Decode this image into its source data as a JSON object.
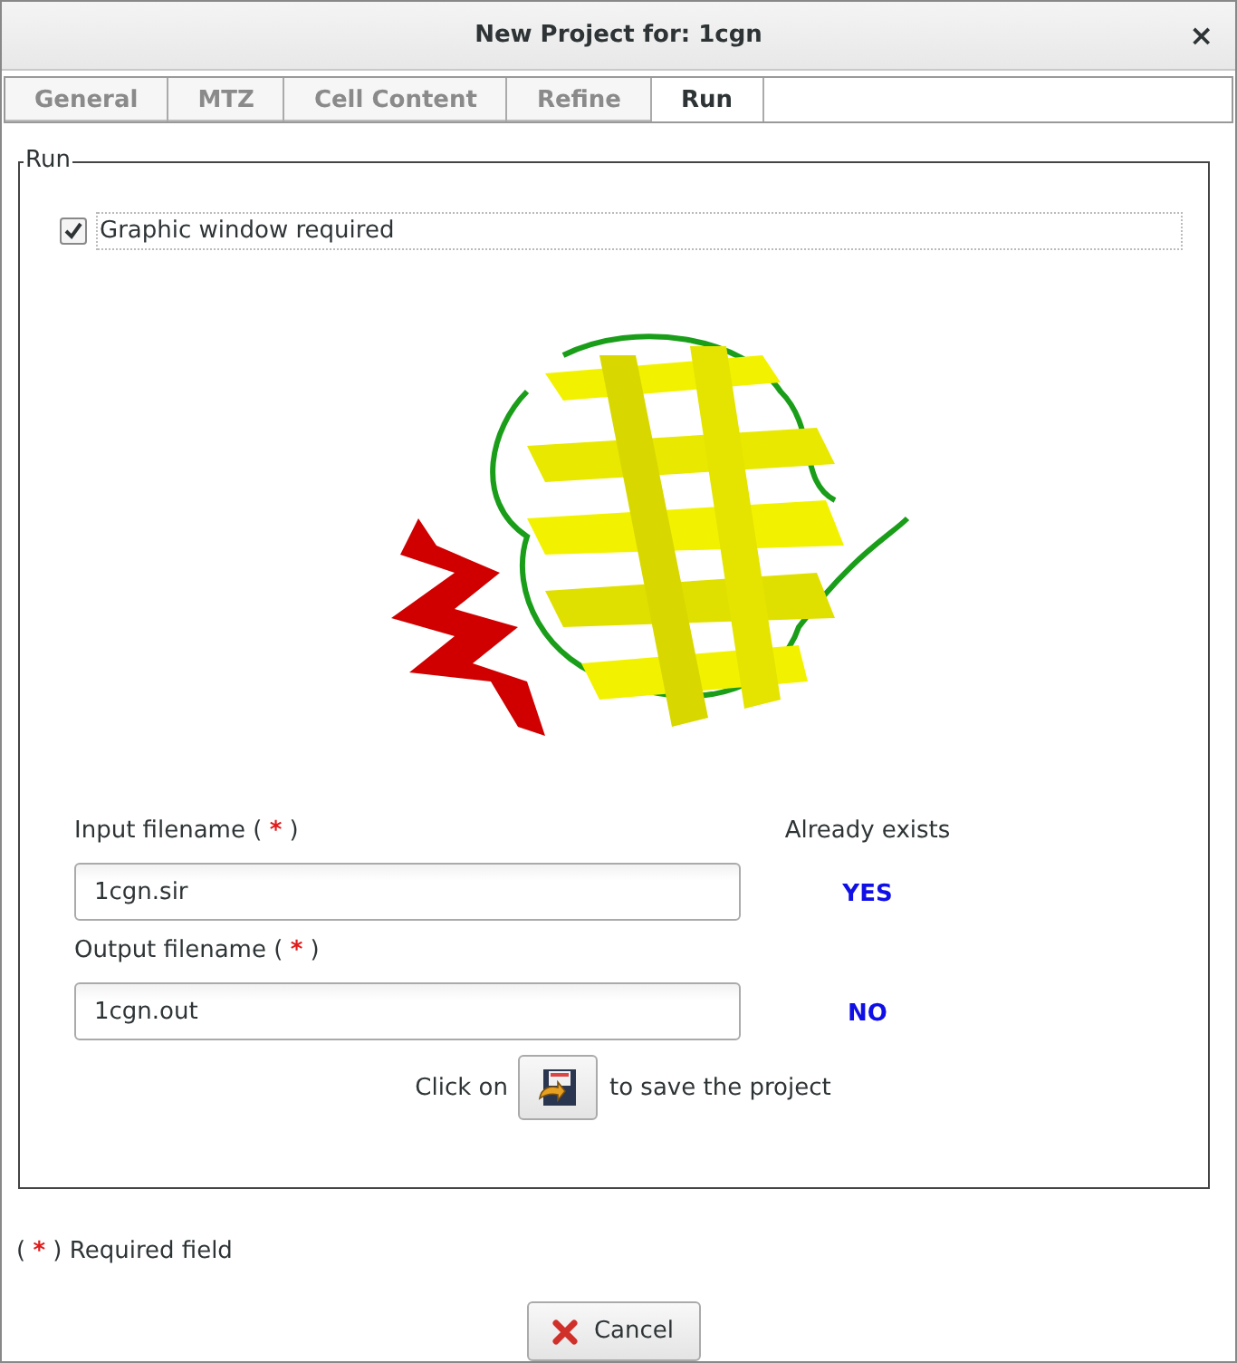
{
  "window": {
    "title": "New Project for: 1cgn",
    "close": "×"
  },
  "tabs": [
    {
      "label": "General",
      "selected": false
    },
    {
      "label": "MTZ",
      "selected": false
    },
    {
      "label": "Cell Content",
      "selected": false
    },
    {
      "label": "Refine",
      "selected": false
    },
    {
      "label": "Run",
      "selected": true
    }
  ],
  "group": {
    "title": "Run",
    "graphic_window": {
      "label": "Graphic window required",
      "checked": true
    },
    "exists_header": "Already exists",
    "files": [
      {
        "label": "Input filename",
        "open": "(",
        "mark": "*",
        "close": ")",
        "value": "1cgn.sir",
        "exists": "YES"
      },
      {
        "label": "Output filename",
        "open": "(",
        "mark": "*",
        "close": ")",
        "value": "1cgn.out",
        "exists": "NO"
      }
    ],
    "save_hint": {
      "before": "Click on",
      "after": "to save the project"
    }
  },
  "legend": {
    "open": "(",
    "mark": "*",
    "close": ")",
    "text": "Required field"
  },
  "buttons": [
    {
      "label": "Cancel"
    }
  ]
}
